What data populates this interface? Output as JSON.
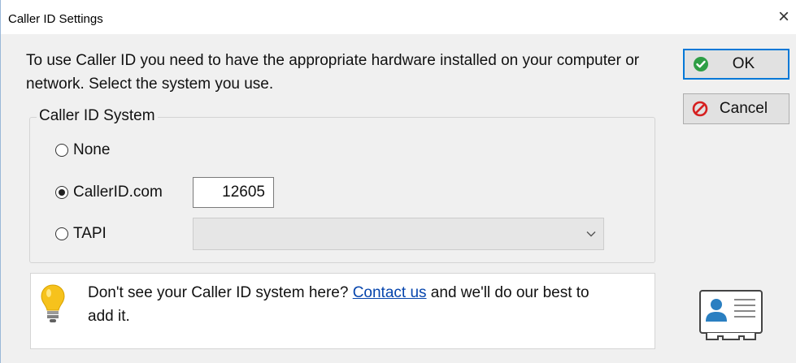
{
  "window": {
    "title": "Caller ID Settings",
    "close_glyph": "×"
  },
  "intro_text": "To use Caller ID you need to have the appropriate hardware installed on your computer or network.  Select the system you use.",
  "buttons": {
    "ok": {
      "label": "OK",
      "icon": "green-check-circle-icon"
    },
    "cancel": {
      "label": "Cancel",
      "icon": "red-no-entry-icon"
    }
  },
  "caller_id_system": {
    "legend": "Caller ID System",
    "options": [
      {
        "label": "None",
        "selected": false
      },
      {
        "label": "CallerID.com",
        "selected": true
      },
      {
        "label": "TAPI",
        "selected": false
      }
    ],
    "callerid_code": "12605",
    "tapi_selected": ""
  },
  "info": {
    "icon": "lightbulb-icon",
    "text_before": "Don't see your Caller ID system here? ",
    "link": "Contact us",
    "text_after": " and we'll do our best to add it."
  },
  "decoration": {
    "icon": "contact-card-icon"
  },
  "colors": {
    "ok_border": "#0078d7",
    "ok_icon": "#2e9e45",
    "cancel_icon": "#d62020",
    "link": "#0645ad",
    "bulb": "#f6c21c"
  }
}
